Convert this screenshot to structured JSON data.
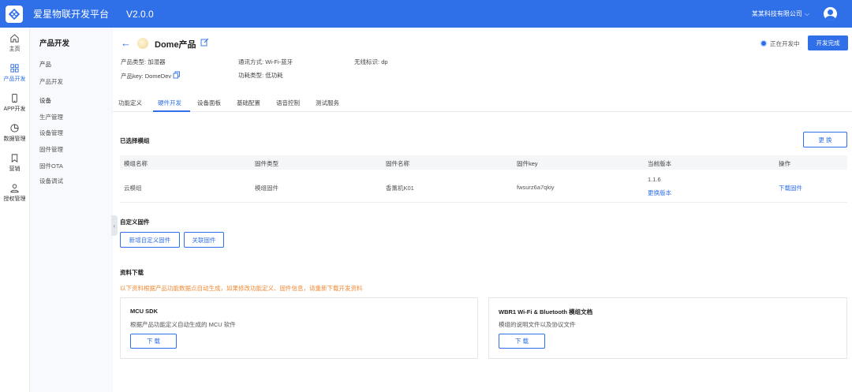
{
  "header": {
    "app_title": "爱星物联开发平台",
    "version": "V2.0.0",
    "company": "某某科技有限公司",
    "company_caret": "⌵"
  },
  "leftnav": [
    {
      "label": "主页",
      "icon": "home-icon",
      "active": false
    },
    {
      "label": "产品开发",
      "icon": "grid-icon",
      "active": true
    },
    {
      "label": "APP开发",
      "icon": "phone-icon",
      "active": false
    },
    {
      "label": "数据管理",
      "icon": "pie-chart-icon",
      "active": false
    },
    {
      "label": "营销",
      "icon": "bookmark-icon",
      "active": false
    },
    {
      "label": "授权管理",
      "icon": "user-icon",
      "active": false
    }
  ],
  "submenu": {
    "title": "产品开发",
    "groups": {
      "product": "产品",
      "device": "设备"
    },
    "items": {
      "product_dev": "产品开发",
      "production": "生产管理",
      "device_mgmt": "设备管理",
      "firmware_mgmt": "固件管理",
      "firmware_ota": "固件OTA",
      "device_debug": "设备调试"
    },
    "collapse_glyph": "‹"
  },
  "product": {
    "back_glyph": "←",
    "name": "Dome产品",
    "status": "正在开发中",
    "complete_button": "开发完成",
    "meta": {
      "type_label": "产品类型:",
      "type_value": "加湿器",
      "comm_label": "通讯方式:",
      "comm_value": "Wi-Fi-蓝牙",
      "wireless_label": "无线标识:",
      "wireless_value": "dp",
      "key_label": "产品key:",
      "key_value": "DomeDev",
      "power_label": "功耗类型:",
      "power_value": "低功耗"
    }
  },
  "tabs": [
    "功能定义",
    "硬件开发",
    "设备面板",
    "基础配置",
    "语音控制",
    "测试服务"
  ],
  "active_tab": 1,
  "module_section": {
    "title": "已选择模组",
    "change_button": "更 换",
    "columns": [
      "模组名称",
      "固件类型",
      "固件名称",
      "固件key",
      "当前版本",
      "操作"
    ],
    "rows": [
      {
        "module_name": "云模组",
        "firmware_type": "模组固件",
        "firmware_name": "香薰机K01",
        "firmware_key": "fwsurz6a7qkiy",
        "version": "1.1.6",
        "change_version": "更换版本",
        "action": "下载固件"
      }
    ]
  },
  "custom_firmware": {
    "title": "自定义固件",
    "add_button": "新增自定义固件",
    "link_button": "关联固件"
  },
  "downloads": {
    "title": "资料下载",
    "notice": "以下资料根据产品功能数据点自动生成，如果修改功能定义、固件信息，请重新下载开发资料",
    "cards": [
      {
        "title": "MCU SDK",
        "desc": "根据产品功能定义自动生成的 MCU 软件",
        "button": "下 载"
      },
      {
        "title": "WBR1 Wi-Fi & Bluetooth 模组文档",
        "desc": "模组的说明文件以及协议文件",
        "button": "下 载"
      }
    ]
  },
  "colors": {
    "primary": "#2f6fe8",
    "notice": "#f08a35"
  }
}
